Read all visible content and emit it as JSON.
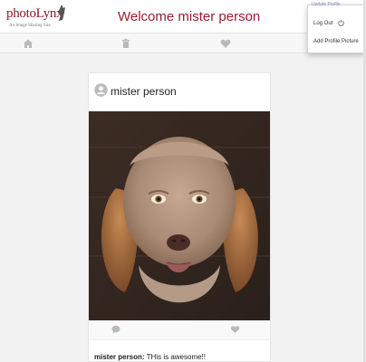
{
  "brand": {
    "logo_text": "photoLynx",
    "tagline": "An Image Sharing Site"
  },
  "header": {
    "title": "Welcome mister person"
  },
  "nav": {
    "icons": [
      "home-icon",
      "trash-icon",
      "heart-icon"
    ]
  },
  "menu": {
    "top_link": "Update Profile",
    "logout_label": "Log Out",
    "add_picture_label": "Add Profile Picture"
  },
  "post": {
    "author": "mister person",
    "image_alt": "shaggy dog with a human-like face",
    "comment": {
      "user": "mister person:",
      "text": " THis is awesome!!"
    }
  },
  "colors": {
    "brand": "#8b1a2b",
    "title": "#9b1b30",
    "icon": "#b9b9b9"
  }
}
